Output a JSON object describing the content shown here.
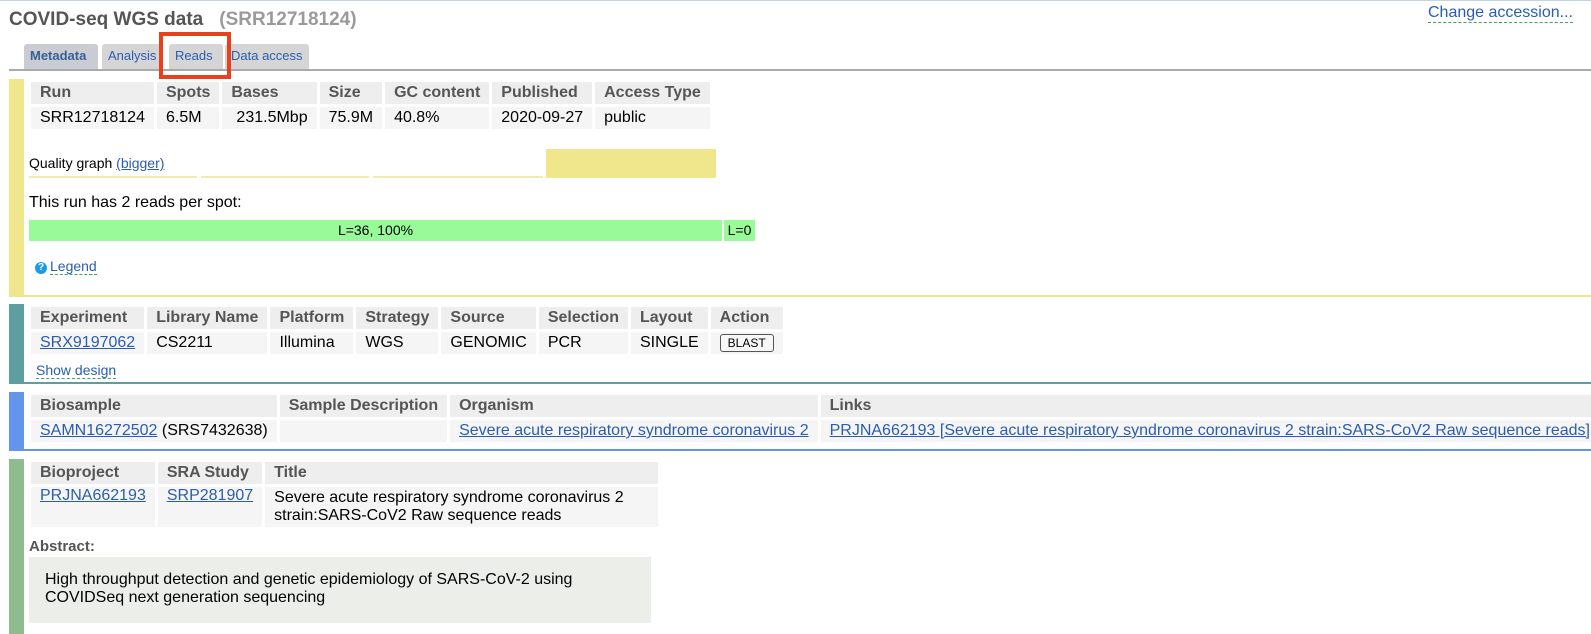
{
  "header": {
    "title": "COVID-seq WGS data",
    "accession": "(SRR12718124)",
    "change_accession": "Change accession..."
  },
  "tabs": [
    "Metadata",
    "Analysis",
    "Reads",
    "Data access"
  ],
  "colors": {
    "run_bar": "#f0e68c",
    "experiment_bar": "#5f9ea0",
    "biosample_bar": "#6495ed",
    "bioproject_bar": "#8fbc8f",
    "read_bar": "#98fb98",
    "highlight": "#e8401c"
  },
  "run": {
    "headers": [
      "Run",
      "Spots",
      "Bases",
      "Size",
      "GC content",
      "Published",
      "Access Type"
    ],
    "values": [
      "SRR12718124",
      "6.5M",
      "231.5Mbp",
      "75.9M",
      "40.8%",
      "2020-09-27",
      "public"
    ]
  },
  "quality": {
    "label": "Quality graph",
    "bigger": "(bigger)"
  },
  "reads": {
    "text": "This run has 2 reads per spot:",
    "bars": [
      {
        "label": "L=36, 100%",
        "fraction": 1.0
      },
      {
        "label": "L=0",
        "fraction": 0.0
      }
    ],
    "legend": "Legend",
    "legend_icon": "question-circle-icon"
  },
  "experiment": {
    "headers": [
      "Experiment",
      "Library Name",
      "Platform",
      "Strategy",
      "Source",
      "Selection",
      "Layout",
      "Action"
    ],
    "values": [
      "SRX9197062",
      "CS2211",
      "Illumina",
      "WGS",
      "GENOMIC",
      "PCR",
      "SINGLE"
    ],
    "blast": "BLAST",
    "show_design": "Show design"
  },
  "biosample": {
    "headers": [
      "Biosample",
      "Sample Description",
      "Organism",
      "Links"
    ],
    "biosample_link": "SAMN16272502",
    "biosample_extra": "(SRS7432638)",
    "description": "",
    "organism": "Severe acute respiratory syndrome coronavirus 2",
    "links": "PRJNA662193 [Severe acute respiratory syndrome coronavirus 2 strain:SARS-CoV2 Raw sequence reads]"
  },
  "bioproject": {
    "headers": [
      "Bioproject",
      "SRA Study",
      "Title"
    ],
    "bioproject": "PRJNA662193",
    "study": "SRP281907",
    "title": "Severe acute respiratory syndrome coronavirus 2 strain:SARS-CoV2 Raw sequence reads",
    "abstract_label": "Abstract:",
    "abstract": "High throughput detection and genetic epidemiology of SARS-CoV-2 using COVIDSeq next generation sequencing"
  }
}
